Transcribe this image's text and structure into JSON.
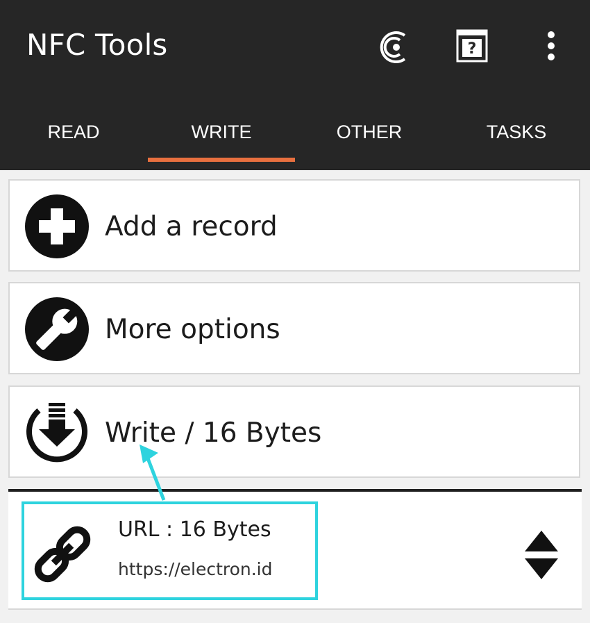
{
  "app": {
    "title": "NFC Tools"
  },
  "toolbar": {
    "icons": [
      "circle-c-icon",
      "help-book-icon",
      "more-vert-icon"
    ]
  },
  "tabs": [
    {
      "label": "READ",
      "active": false
    },
    {
      "label": "WRITE",
      "active": true
    },
    {
      "label": "OTHER",
      "active": false
    },
    {
      "label": "TASKS",
      "active": false
    }
  ],
  "actions": [
    {
      "label": "Add a record",
      "icon": "add-circle-icon"
    },
    {
      "label": "More options",
      "icon": "wrench-icon"
    },
    {
      "label": "Write / 16 Bytes",
      "icon": "download-circle-icon"
    }
  ],
  "records": [
    {
      "title": "URL : 16 Bytes",
      "value": "https://electron.id",
      "icon": "link-icon"
    }
  ],
  "colors": {
    "appbar": "#262626",
    "tab_indicator": "#e8703f",
    "highlight": "#2ed3de"
  }
}
